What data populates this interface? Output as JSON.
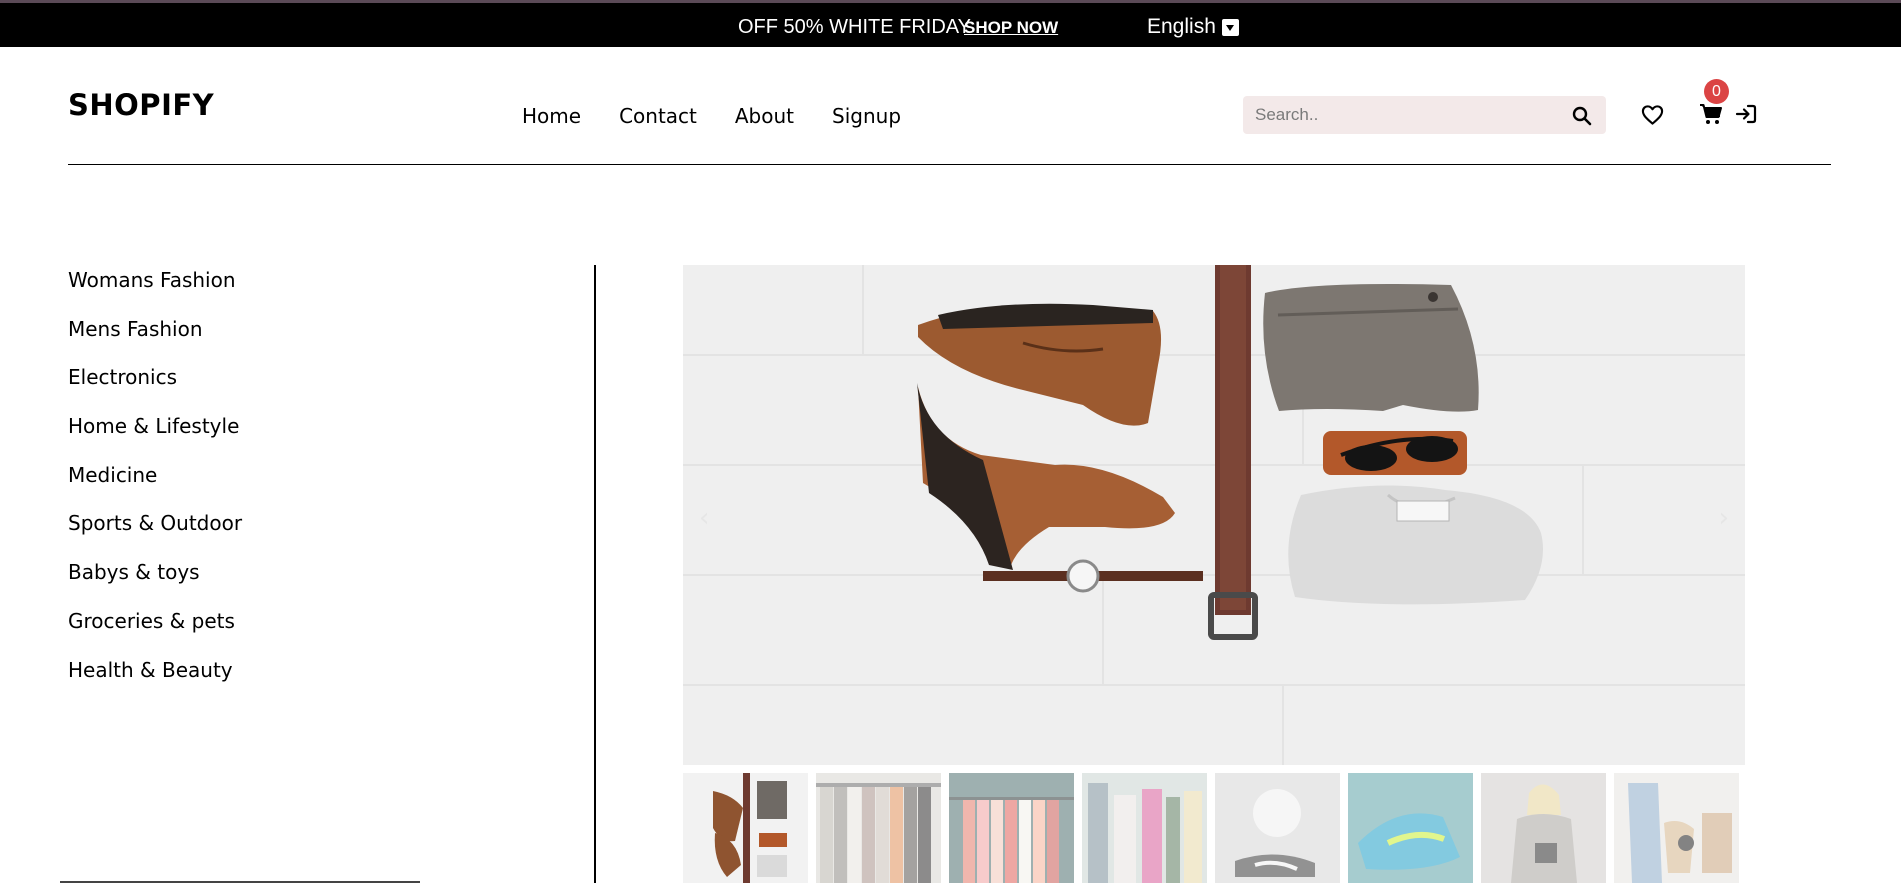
{
  "announcement": {
    "offer_text": "OFF 50% WHITE FRIDAY",
    "shop_link": "SHOP NOW",
    "language": "English"
  },
  "header": {
    "logo": "SHOPIFY",
    "nav": [
      "Home",
      "Contact",
      "About",
      "Signup"
    ],
    "search_placeholder": "Search..",
    "cart_count": "0",
    "icons": [
      "search-icon",
      "heart-icon",
      "cart-icon",
      "login-icon"
    ]
  },
  "categories": [
    "Womans Fashion",
    "Mens Fashion",
    "Electronics",
    "Home & Lifestyle",
    "Medicine",
    "Sports & Outdoor",
    "Babys & toys",
    "Groceries & pets",
    "Health & Beauty"
  ],
  "carousel": {
    "prev_glyph": "‹",
    "next_glyph": "›",
    "thumbnail_count": 8,
    "active_thumbnail": 1
  },
  "colors": {
    "announcement_bg": "#000000",
    "search_bg": "#f3e9e9",
    "badge": "#db4444"
  }
}
